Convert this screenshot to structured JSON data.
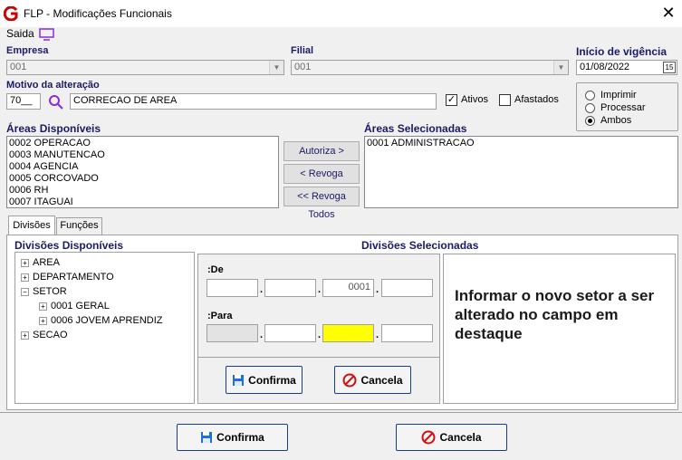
{
  "window": {
    "title": "FLP - Modificações Funcionais"
  },
  "menu": {
    "saida_label": "Saida"
  },
  "empresa": {
    "label": "Empresa",
    "value": "001"
  },
  "filial": {
    "label": "Filial",
    "value": "001"
  },
  "vigencia": {
    "label": "Início de vigência",
    "value": "01/08/2022",
    "cal_label": "15"
  },
  "motivo": {
    "label": "Motivo da alteração",
    "code": "70__",
    "description": "CORRECAO DE AREA"
  },
  "filters": {
    "ativos_label": "Ativos",
    "ativos_checked": true,
    "afastados_label": "Afastados",
    "afastados_checked": false
  },
  "mode": {
    "options": [
      "Imprimir",
      "Processar",
      "Ambos"
    ],
    "selected": "Ambos"
  },
  "areas_disponiveis": {
    "label": "Áreas Disponíveis",
    "items": [
      "0002 OPERACAO",
      "0003 MANUTENCAO",
      "0004 AGENCIA",
      "0005 CORCOVADO",
      "0006 RH",
      "0007 ITAGUAI"
    ]
  },
  "areas_selecionadas": {
    "label": "Áreas Selecionadas",
    "items": [
      "0001 ADMINISTRACAO"
    ]
  },
  "area_buttons": {
    "autoriza": "Autoriza >",
    "revoga": "< Revoga",
    "revoga_todos": "<< Revoga Todos"
  },
  "tabs": [
    "Divisões",
    "Funções"
  ],
  "divisoes": {
    "disponiveis_label": "Divisões Disponíveis",
    "selecionadas_label": "Divisões Selecionadas",
    "tree": {
      "area": "AREA",
      "departamento": "DEPARTAMENTO",
      "setor": "SETOR",
      "setor_children": [
        "0001 GERAL",
        "0006 JOVEM APRENDIZ"
      ],
      "secao": "SECAO"
    }
  },
  "de": {
    "label": ":De",
    "segments": [
      "",
      "",
      "0001",
      ""
    ]
  },
  "para": {
    "label": ":Para",
    "segments": [
      "",
      "",
      "",
      ""
    ]
  },
  "inner_buttons": {
    "confirma": "Confirma",
    "cancela": "Cancela"
  },
  "hint": "Informar o novo setor a ser alterado no campo em destaque",
  "footer": {
    "confirma": "Confirma",
    "cancela": "Cancela"
  },
  "colors": {
    "label": "#1a1a66",
    "highlight": "#ffff00",
    "brand": "#cc0000"
  }
}
